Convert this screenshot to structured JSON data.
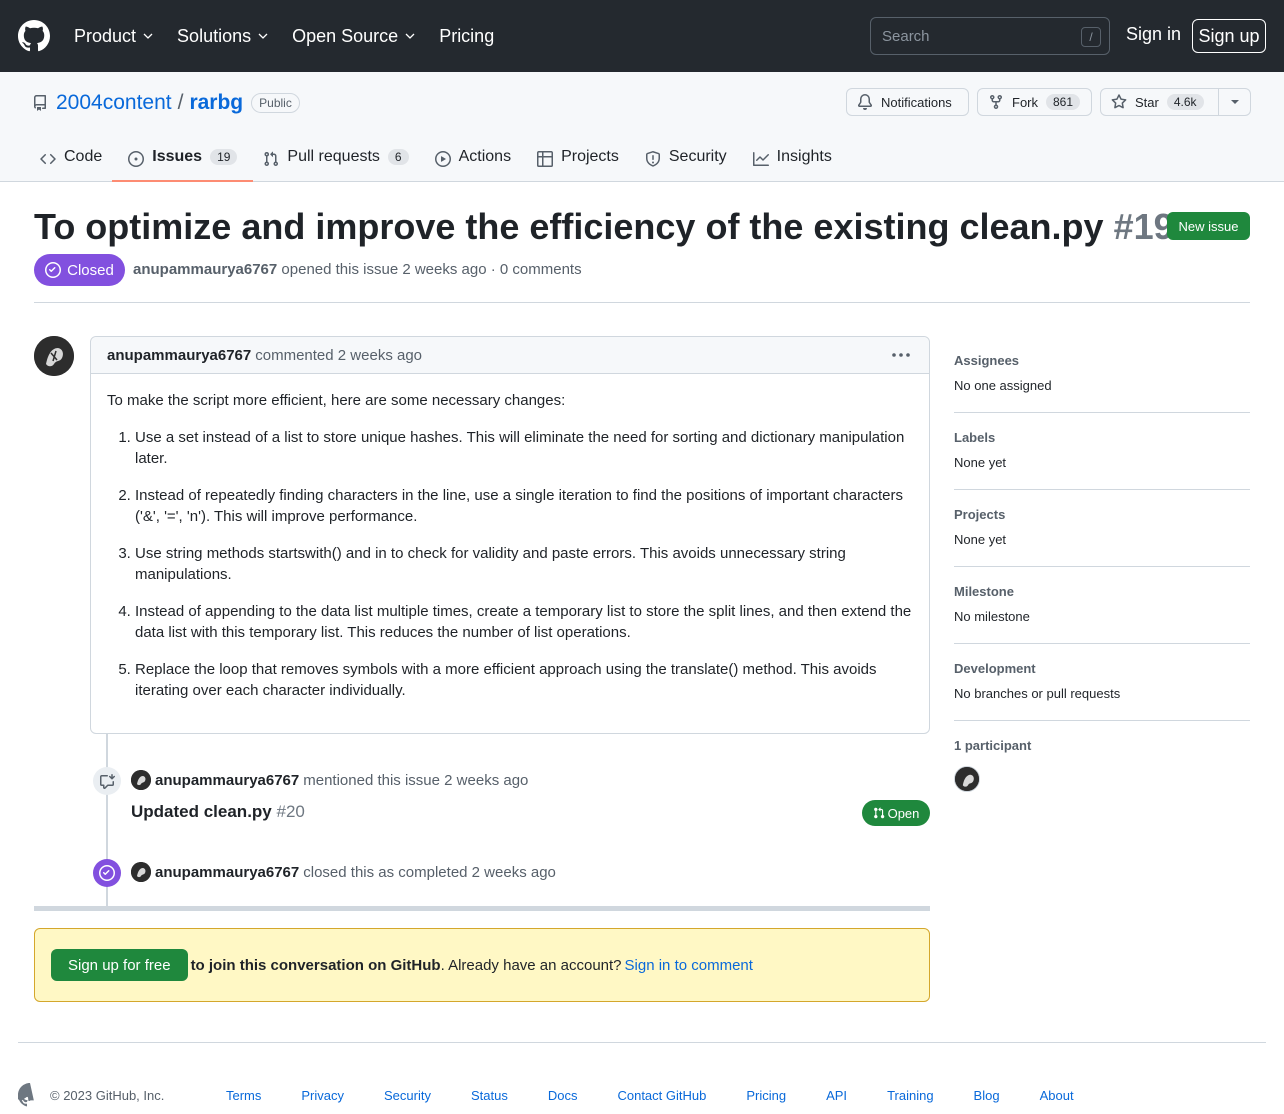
{
  "header": {
    "nav": [
      "Product",
      "Solutions",
      "Open Source",
      "Pricing"
    ],
    "search_placeholder": "Search",
    "search_shortcut": "/",
    "sign_in": "Sign in",
    "sign_up": "Sign up"
  },
  "repo": {
    "owner": "2004content",
    "separator": "/",
    "name": "rarbg",
    "visibility": "Public",
    "notifications_label": "Notifications",
    "fork_label": "Fork",
    "fork_count": "861",
    "star_label": "Star",
    "star_count": "4.6k"
  },
  "tabs": [
    {
      "label": "Code",
      "icon": "code-icon"
    },
    {
      "label": "Issues",
      "icon": "issue-opened-icon",
      "count": "19",
      "active": true
    },
    {
      "label": "Pull requests",
      "icon": "git-pull-request-icon",
      "count": "6"
    },
    {
      "label": "Actions",
      "icon": "play-icon"
    },
    {
      "label": "Projects",
      "icon": "table-icon"
    },
    {
      "label": "Security",
      "icon": "shield-icon"
    },
    {
      "label": "Insights",
      "icon": "graph-icon"
    }
  ],
  "issue": {
    "title": "To optimize and improve the efficiency of the existing clean.py",
    "number": "#19",
    "new_issue_label": "New issue",
    "state": "Closed",
    "author": "anupammaurya6767",
    "opened_text": "opened this issue 2 weeks ago",
    "dot": "·",
    "comments_count_text": "0 comments"
  },
  "comment": {
    "author": "anupammaurya6767",
    "meta": "commented 2 weeks ago",
    "intro": "To make the script more efficient, here are some necessary changes:",
    "items": [
      "Use a set instead of a list to store unique hashes. This will eliminate the need for sorting and dictionary manipulation later.",
      "Instead of repeatedly finding characters in the line, use a single iteration to find the positions of important characters ('&', '=', 'n'). This will improve performance.",
      "Use string methods startswith() and in to check for validity and paste errors. This avoids unnecessary string manipulations.",
      "Instead of appending to the data list multiple times, create a temporary list to store the split lines, and then extend the data list with this temporary list. This reduces the number of list operations.",
      "Replace the loop that removes symbols with a more efficient approach using the translate() method. This avoids iterating over each character individually."
    ]
  },
  "timeline": {
    "mention": {
      "author": "anupammaurya6767",
      "text": "mentioned this issue 2 weeks ago",
      "pr_title": "Updated clean.py",
      "pr_number": "#20",
      "pr_state": "Open"
    },
    "closed": {
      "author": "anupammaurya6767",
      "text": "closed this as completed 2 weeks ago"
    }
  },
  "banner": {
    "button": "Sign up for free",
    "bold_text": "to join this conversation on GitHub",
    "text": ". Already have an account?",
    "link": "Sign in to comment"
  },
  "sidebar": [
    {
      "heading": "Assignees",
      "value": "No one assigned"
    },
    {
      "heading": "Labels",
      "value": "None yet"
    },
    {
      "heading": "Projects",
      "value": "None yet"
    },
    {
      "heading": "Milestone",
      "value": "No milestone"
    },
    {
      "heading": "Development",
      "value": "No branches or pull requests"
    }
  ],
  "participants_heading": "1 participant",
  "footer": {
    "copyright": "© 2023 GitHub, Inc.",
    "links": [
      "Terms",
      "Privacy",
      "Security",
      "Status",
      "Docs",
      "Contact GitHub",
      "Pricing",
      "API",
      "Training",
      "Blog",
      "About"
    ]
  },
  "colors": {
    "header_bg": "#24292f",
    "accent_link": "#0969da",
    "closed_purple": "#8250df",
    "open_green": "#1f883d",
    "tab_underline": "#fd8c73",
    "banner_bg": "#fff8c5"
  }
}
